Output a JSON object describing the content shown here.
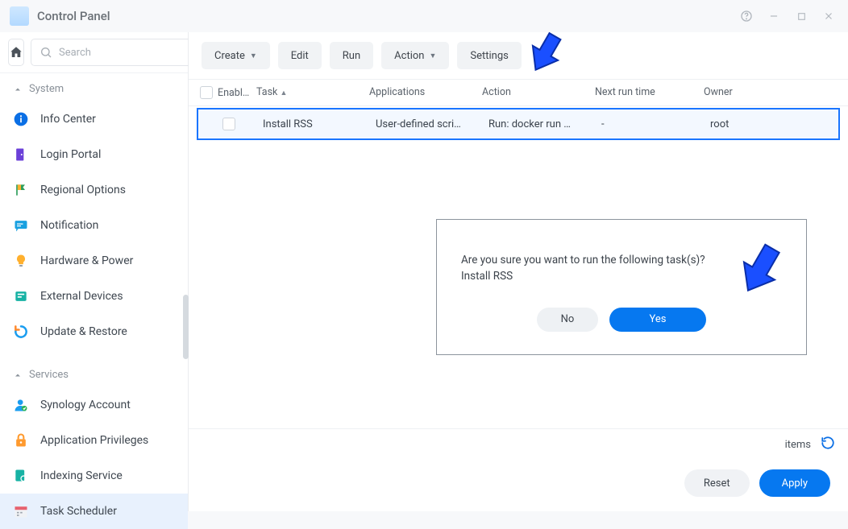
{
  "window": {
    "title": "Control Panel"
  },
  "search": {
    "placeholder": "Search"
  },
  "sections": {
    "system": "System",
    "services": "Services"
  },
  "sidebar": {
    "system": [
      {
        "label": "Info Center"
      },
      {
        "label": "Login Portal"
      },
      {
        "label": "Regional Options"
      },
      {
        "label": "Notification"
      },
      {
        "label": "Hardware & Power"
      },
      {
        "label": "External Devices"
      },
      {
        "label": "Update & Restore"
      }
    ],
    "services": [
      {
        "label": "Synology Account"
      },
      {
        "label": "Application Privileges"
      },
      {
        "label": "Indexing Service"
      },
      {
        "label": "Task Scheduler"
      }
    ]
  },
  "toolbar": {
    "create": "Create",
    "edit": "Edit",
    "run": "Run",
    "action": "Action",
    "settings": "Settings"
  },
  "table": {
    "headers": {
      "enabled": "Enabl…",
      "task": "Task",
      "applications": "Applications",
      "action": "Action",
      "next": "Next run time",
      "owner": "Owner"
    },
    "row": {
      "task": "Install RSS",
      "applications": "User-defined scri…",
      "action": "Run: docker run …",
      "next": "-",
      "owner": "root"
    }
  },
  "dialog": {
    "line1": "Are you sure you want to run the following task(s)?",
    "line2": "Install RSS",
    "no": "No",
    "yes": "Yes"
  },
  "footer": {
    "items": "items",
    "reset": "Reset",
    "apply": "Apply"
  }
}
